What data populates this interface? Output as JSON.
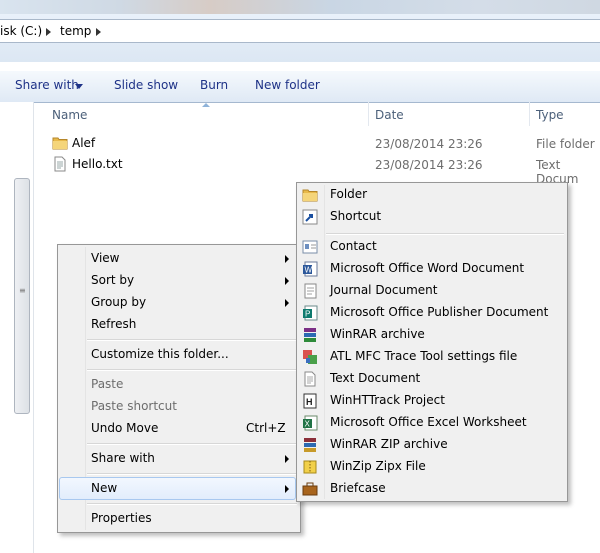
{
  "address": {
    "crumbs": [
      "isk (C:)",
      "temp"
    ]
  },
  "toolbar": {
    "share_with": "Share with",
    "slide_show": "Slide show",
    "burn": "Burn",
    "new_folder": "New folder"
  },
  "columns": {
    "name": "Name",
    "date": "Date",
    "type": "Type"
  },
  "files": [
    {
      "name": "Alef",
      "date": "23/08/2014 23:26",
      "type": "File folder"
    },
    {
      "name": "Hello.txt",
      "date": "23/08/2014 23:26",
      "type": "Text Docum"
    }
  ],
  "context_menu": {
    "view": "View",
    "sort_by": "Sort by",
    "group_by": "Group by",
    "refresh": "Refresh",
    "customize": "Customize this folder...",
    "paste": "Paste",
    "paste_shortcut": "Paste shortcut",
    "undo_move": "Undo Move",
    "undo_shortcut": "Ctrl+Z",
    "share_with": "Share with",
    "new": "New",
    "properties": "Properties"
  },
  "new_submenu": [
    "Folder",
    "Shortcut",
    "Contact",
    "Microsoft Office Word Document",
    "Journal Document",
    "Microsoft Office Publisher Document",
    "WinRAR archive",
    "ATL MFC Trace Tool settings file",
    "Text Document",
    "WinHTTrack Project",
    "Microsoft Office Excel Worksheet",
    "WinRAR ZIP archive",
    "WinZip Zipx File",
    "Briefcase"
  ],
  "icons": [
    "folder-icon",
    "shortcut-icon",
    "contact-icon",
    "word-doc-icon",
    "journal-icon",
    "publisher-icon",
    "winrar-icon",
    "atl-trace-icon",
    "text-doc-icon",
    "winhttrack-icon",
    "excel-icon",
    "winrar-zip-icon",
    "winzip-icon",
    "briefcase-icon"
  ]
}
